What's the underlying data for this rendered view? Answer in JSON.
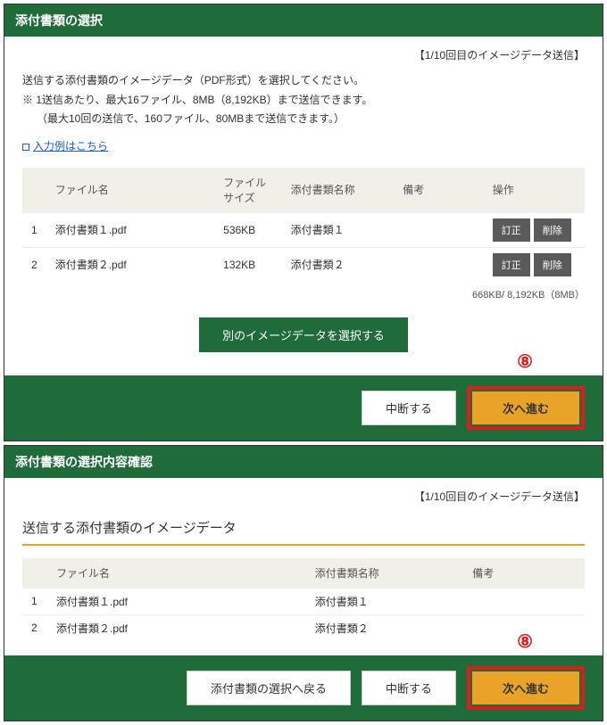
{
  "panel1": {
    "title": "添付書類の選択",
    "counter": "【1/10回目のイメージデータ送信】",
    "desc_line1": "送信する添付書類のイメージデータ（PDF形式）を選択してください。",
    "desc_line2": "※ 1送信あたり、最大16ファイル、8MB（8,192KB）まで送信できます。",
    "desc_line3": "（最大10回の送信で、160ファイル、80MBまで送信できます。）",
    "link_text": "入力例はこちら",
    "table": {
      "headers": {
        "num": "",
        "filename": "ファイル名",
        "filesize": "ファイルサイズ",
        "docname": "添付書類名称",
        "note": "備考",
        "ops": "操作"
      },
      "rows": [
        {
          "num": "1",
          "filename": "添付書類１.pdf",
          "filesize": "536KB",
          "docname": "添付書類１",
          "note": ""
        },
        {
          "num": "2",
          "filename": "添付書類２.pdf",
          "filesize": "132KB",
          "docname": "添付書類２",
          "note": ""
        }
      ],
      "ops": {
        "edit": "訂正",
        "delete": "削除"
      }
    },
    "size_summary": "668KB/ 8,192KB（8MB）",
    "select_more": "別のイメージデータを選択する",
    "cancel": "中断する",
    "next": "次へ進む",
    "callout": "⑧"
  },
  "panel2": {
    "title": "添付書類の選択内容確認",
    "counter": "【1/10回目のイメージデータ送信】",
    "subheading": "送信する添付書類のイメージデータ",
    "table": {
      "headers": {
        "num": "",
        "filename": "ファイル名",
        "docname": "添付書類名称",
        "note": "備考"
      },
      "rows": [
        {
          "num": "1",
          "filename": "添付書類１.pdf",
          "docname": "添付書類１",
          "note": ""
        },
        {
          "num": "2",
          "filename": "添付書類２.pdf",
          "docname": "添付書類２",
          "note": ""
        }
      ]
    },
    "back": "添付書類の選択へ戻る",
    "cancel": "中断する",
    "next": "次へ進む",
    "callout": "⑧"
  }
}
